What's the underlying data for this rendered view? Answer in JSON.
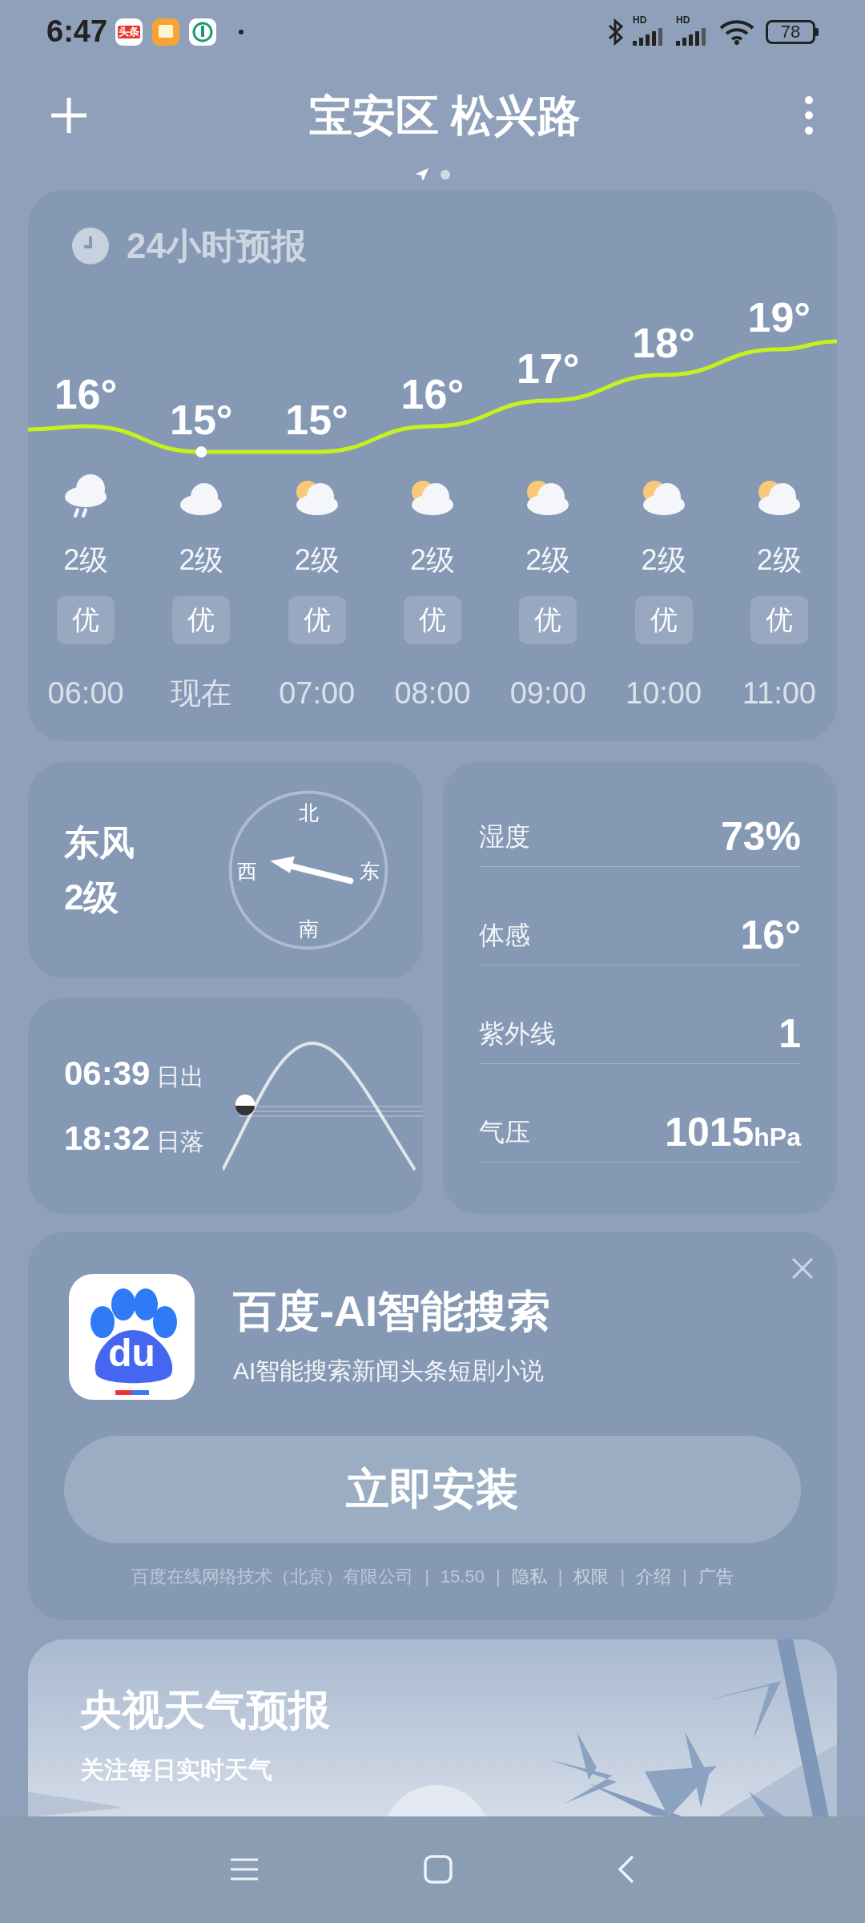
{
  "status_bar": {
    "time": "6:47",
    "notification_badge": "头条",
    "signal_labels": [
      "HD",
      "HD"
    ],
    "battery": "78"
  },
  "header": {
    "location": "宝安区 松兴路",
    "pages": [
      {
        "kind": "location",
        "selected": true
      },
      {
        "kind": "dot",
        "selected": false
      }
    ]
  },
  "hourly_forecast": {
    "title": "24小时预报",
    "hours": [
      {
        "temp": "16°",
        "kind": "rain",
        "wind": "2级",
        "aqi": "优",
        "time": "06:00",
        "current": false
      },
      {
        "temp": "15°",
        "kind": "cloudy",
        "wind": "2级",
        "aqi": "优",
        "time": "现在",
        "current": true
      },
      {
        "temp": "15°",
        "kind": "partly_cloudy",
        "wind": "2级",
        "aqi": "优",
        "time": "07:00",
        "current": false
      },
      {
        "temp": "16°",
        "kind": "partly_cloudy",
        "wind": "2级",
        "aqi": "优",
        "time": "08:00",
        "current": false
      },
      {
        "temp": "17°",
        "kind": "partly_cloudy",
        "wind": "2级",
        "aqi": "优",
        "time": "09:00",
        "current": false
      },
      {
        "temp": "18°",
        "kind": "partly_cloudy",
        "wind": "2级",
        "aqi": "优",
        "time": "10:00",
        "current": false
      },
      {
        "temp": "19°",
        "kind": "partly_cloudy",
        "wind": "2级",
        "aqi": "优",
        "time": "11:00",
        "current": false
      }
    ]
  },
  "wind": {
    "direction": "东风",
    "level": "2级",
    "compass": {
      "north": "北",
      "west": "西",
      "east": "东",
      "south": "南"
    }
  },
  "sun": {
    "sunrise_time": "06:39",
    "sunrise_label": "日出",
    "sunset_time": "18:32",
    "sunset_label": "日落"
  },
  "details": [
    {
      "label": "湿度",
      "value": "73%"
    },
    {
      "label": "体感",
      "value": "16°"
    },
    {
      "label": "紫外线",
      "value": "1"
    },
    {
      "label": "气压",
      "value": "1015",
      "unit": "hPa"
    }
  ],
  "ad": {
    "icon_text": "du",
    "app_name": "百度-AI智能搜索",
    "tagline": "AI智能搜索新闻头条短剧小说",
    "button": "立即安装",
    "separator": "|",
    "footer": [
      {
        "kind": "text",
        "text": "百度在线网络技术（北京）有限公司"
      },
      {
        "kind": "text",
        "text": "15.50"
      },
      {
        "kind": "link",
        "text": "隐私"
      },
      {
        "kind": "link",
        "text": "权限"
      },
      {
        "kind": "link",
        "text": "介绍"
      },
      {
        "kind": "link",
        "text": "广告"
      }
    ]
  },
  "promo": {
    "title": "央视天气预报",
    "subtitle": "关注每日实时天气"
  }
}
